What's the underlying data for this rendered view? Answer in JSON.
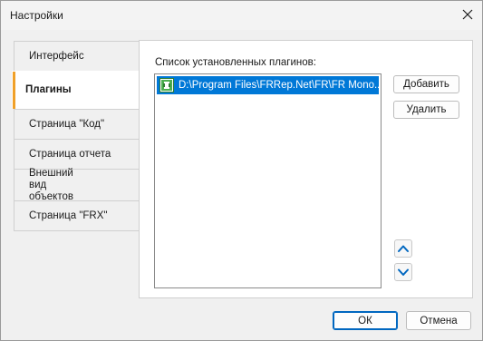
{
  "window": {
    "title": "Настройки"
  },
  "tabs": [
    {
      "label": "Интерфейс",
      "active": false
    },
    {
      "label": "Плагины",
      "active": true
    },
    {
      "label": "Страница \"Код\"",
      "active": false
    },
    {
      "label": "Страница отчета",
      "active": false
    },
    {
      "label": "Внешний вид объектов",
      "active": false
    },
    {
      "label": "Страница \"FRX\"",
      "active": false
    }
  ],
  "plugins": {
    "list_label": "Список установленных плагинов:",
    "items": [
      {
        "path": "D:\\Program Files\\FRRep.Net\\FR\\FR Mono...",
        "selected": true,
        "icon": "plugin-icon"
      }
    ],
    "add_label": "Добавить",
    "remove_label": "Удалить",
    "move_up_icon": "chevron-up-icon",
    "move_down_icon": "chevron-down-icon"
  },
  "footer": {
    "ok_label": "ОК",
    "cancel_label": "Отмена"
  },
  "colors": {
    "selection": "#0078d7",
    "active_tab_marker": "#f0a028",
    "arrow": "#0067c0"
  }
}
